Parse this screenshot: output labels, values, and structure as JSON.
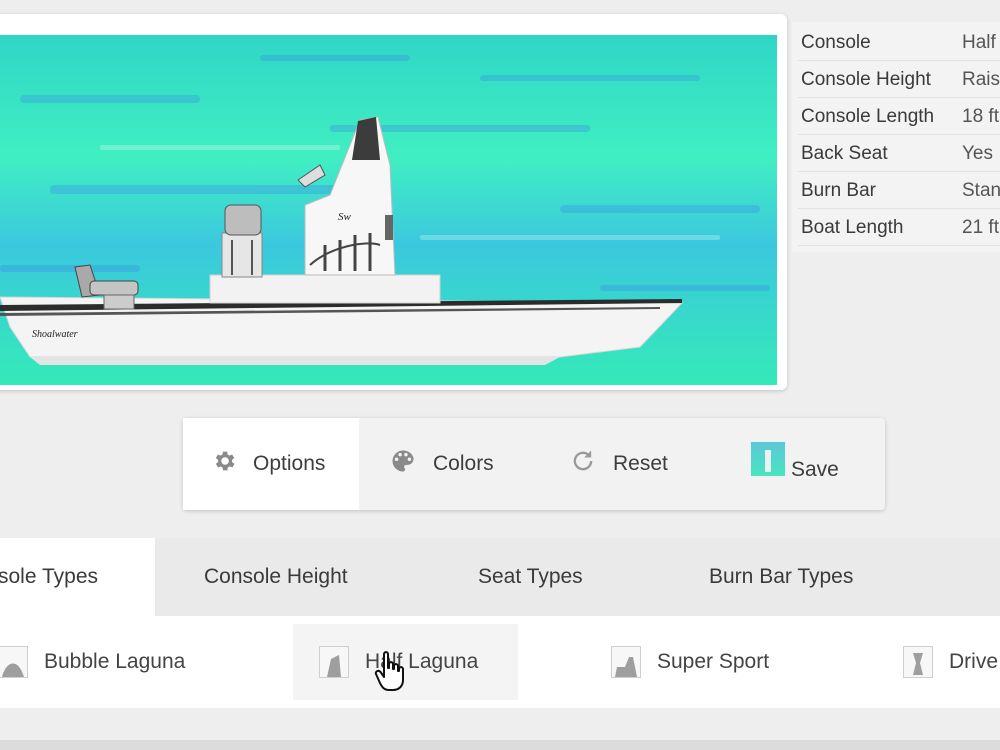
{
  "specs": [
    {
      "key": "Console",
      "value": "Half"
    },
    {
      "key": "Console Height",
      "value": "Rais"
    },
    {
      "key": "Console Length",
      "value": "18 ft"
    },
    {
      "key": "Back Seat",
      "value": "Yes"
    },
    {
      "key": "Burn Bar",
      "value": "Stan"
    },
    {
      "key": "Boat Length",
      "value": "21 ft"
    }
  ],
  "toolbar": {
    "options_label": "Options",
    "colors_label": "Colors",
    "reset_label": "Reset",
    "save_label": "Save"
  },
  "tabs": [
    {
      "label": "sole Types",
      "active": true
    },
    {
      "label": "Console Height"
    },
    {
      "label": "Seat Types"
    },
    {
      "label": "Burn Bar Types"
    }
  ],
  "console_types": [
    {
      "label": "Bubble Laguna"
    },
    {
      "label": "Half Laguna",
      "hover": true
    },
    {
      "label": "Super Sport"
    },
    {
      "label": "Drive"
    }
  ],
  "colors": {
    "water_light": "#3ff0c4",
    "water_blue": "#3ab4e6",
    "hull": "#f4f4f4",
    "accent": "#333333"
  },
  "icons": {
    "options": "gear-icon",
    "colors": "palette-icon",
    "reset": "reset-icon",
    "save": "save-thumbnail-icon"
  }
}
